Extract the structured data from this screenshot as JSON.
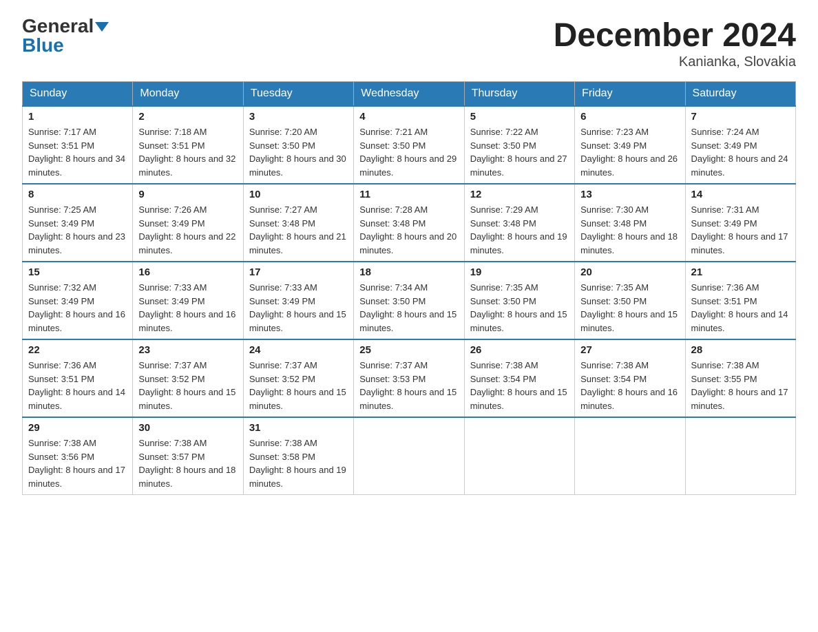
{
  "header": {
    "logo_general": "General",
    "logo_blue": "Blue",
    "month_title": "December 2024",
    "location": "Kanianka, Slovakia"
  },
  "weekdays": [
    "Sunday",
    "Monday",
    "Tuesday",
    "Wednesday",
    "Thursday",
    "Friday",
    "Saturday"
  ],
  "weeks": [
    [
      {
        "day": "1",
        "sunrise": "7:17 AM",
        "sunset": "3:51 PM",
        "daylight": "8 hours and 34 minutes."
      },
      {
        "day": "2",
        "sunrise": "7:18 AM",
        "sunset": "3:51 PM",
        "daylight": "8 hours and 32 minutes."
      },
      {
        "day": "3",
        "sunrise": "7:20 AM",
        "sunset": "3:50 PM",
        "daylight": "8 hours and 30 minutes."
      },
      {
        "day": "4",
        "sunrise": "7:21 AM",
        "sunset": "3:50 PM",
        "daylight": "8 hours and 29 minutes."
      },
      {
        "day": "5",
        "sunrise": "7:22 AM",
        "sunset": "3:50 PM",
        "daylight": "8 hours and 27 minutes."
      },
      {
        "day": "6",
        "sunrise": "7:23 AM",
        "sunset": "3:49 PM",
        "daylight": "8 hours and 26 minutes."
      },
      {
        "day": "7",
        "sunrise": "7:24 AM",
        "sunset": "3:49 PM",
        "daylight": "8 hours and 24 minutes."
      }
    ],
    [
      {
        "day": "8",
        "sunrise": "7:25 AM",
        "sunset": "3:49 PM",
        "daylight": "8 hours and 23 minutes."
      },
      {
        "day": "9",
        "sunrise": "7:26 AM",
        "sunset": "3:49 PM",
        "daylight": "8 hours and 22 minutes."
      },
      {
        "day": "10",
        "sunrise": "7:27 AM",
        "sunset": "3:48 PM",
        "daylight": "8 hours and 21 minutes."
      },
      {
        "day": "11",
        "sunrise": "7:28 AM",
        "sunset": "3:48 PM",
        "daylight": "8 hours and 20 minutes."
      },
      {
        "day": "12",
        "sunrise": "7:29 AM",
        "sunset": "3:48 PM",
        "daylight": "8 hours and 19 minutes."
      },
      {
        "day": "13",
        "sunrise": "7:30 AM",
        "sunset": "3:48 PM",
        "daylight": "8 hours and 18 minutes."
      },
      {
        "day": "14",
        "sunrise": "7:31 AM",
        "sunset": "3:49 PM",
        "daylight": "8 hours and 17 minutes."
      }
    ],
    [
      {
        "day": "15",
        "sunrise": "7:32 AM",
        "sunset": "3:49 PM",
        "daylight": "8 hours and 16 minutes."
      },
      {
        "day": "16",
        "sunrise": "7:33 AM",
        "sunset": "3:49 PM",
        "daylight": "8 hours and 16 minutes."
      },
      {
        "day": "17",
        "sunrise": "7:33 AM",
        "sunset": "3:49 PM",
        "daylight": "8 hours and 15 minutes."
      },
      {
        "day": "18",
        "sunrise": "7:34 AM",
        "sunset": "3:50 PM",
        "daylight": "8 hours and 15 minutes."
      },
      {
        "day": "19",
        "sunrise": "7:35 AM",
        "sunset": "3:50 PM",
        "daylight": "8 hours and 15 minutes."
      },
      {
        "day": "20",
        "sunrise": "7:35 AM",
        "sunset": "3:50 PM",
        "daylight": "8 hours and 15 minutes."
      },
      {
        "day": "21",
        "sunrise": "7:36 AM",
        "sunset": "3:51 PM",
        "daylight": "8 hours and 14 minutes."
      }
    ],
    [
      {
        "day": "22",
        "sunrise": "7:36 AM",
        "sunset": "3:51 PM",
        "daylight": "8 hours and 14 minutes."
      },
      {
        "day": "23",
        "sunrise": "7:37 AM",
        "sunset": "3:52 PM",
        "daylight": "8 hours and 15 minutes."
      },
      {
        "day": "24",
        "sunrise": "7:37 AM",
        "sunset": "3:52 PM",
        "daylight": "8 hours and 15 minutes."
      },
      {
        "day": "25",
        "sunrise": "7:37 AM",
        "sunset": "3:53 PM",
        "daylight": "8 hours and 15 minutes."
      },
      {
        "day": "26",
        "sunrise": "7:38 AM",
        "sunset": "3:54 PM",
        "daylight": "8 hours and 15 minutes."
      },
      {
        "day": "27",
        "sunrise": "7:38 AM",
        "sunset": "3:54 PM",
        "daylight": "8 hours and 16 minutes."
      },
      {
        "day": "28",
        "sunrise": "7:38 AM",
        "sunset": "3:55 PM",
        "daylight": "8 hours and 17 minutes."
      }
    ],
    [
      {
        "day": "29",
        "sunrise": "7:38 AM",
        "sunset": "3:56 PM",
        "daylight": "8 hours and 17 minutes."
      },
      {
        "day": "30",
        "sunrise": "7:38 AM",
        "sunset": "3:57 PM",
        "daylight": "8 hours and 18 minutes."
      },
      {
        "day": "31",
        "sunrise": "7:38 AM",
        "sunset": "3:58 PM",
        "daylight": "8 hours and 19 minutes."
      },
      null,
      null,
      null,
      null
    ]
  ]
}
